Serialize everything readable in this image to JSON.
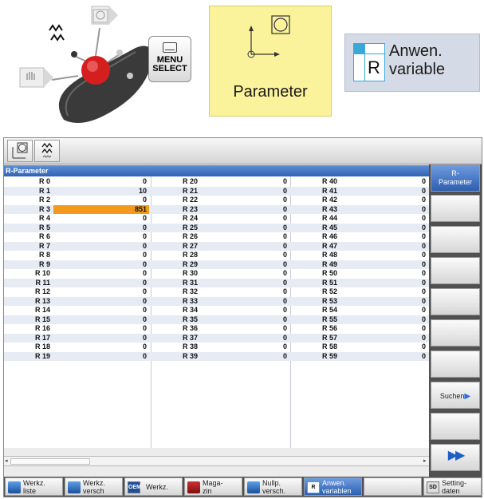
{
  "illustration": {
    "menu_key": {
      "line1": "MENU",
      "line2": "SELECT"
    },
    "parameter_label": "Parameter",
    "anwen": {
      "icon_letter": "R",
      "line1": "Anwen.",
      "line2": "variable"
    }
  },
  "screen": {
    "title": "R-Parameter",
    "table": {
      "selected_row": 3,
      "rows": [
        {
          "n0": "R 0",
          "v0": "0",
          "n1": "R 20",
          "v1": "0",
          "n2": "R 40",
          "v2": "0"
        },
        {
          "n0": "R 1",
          "v0": "10",
          "n1": "R 21",
          "v1": "0",
          "n2": "R 41",
          "v2": "0"
        },
        {
          "n0": "R 2",
          "v0": "0",
          "n1": "R 22",
          "v1": "0",
          "n2": "R 42",
          "v2": "0"
        },
        {
          "n0": "R 3",
          "v0": "851",
          "n1": "R 23",
          "v1": "0",
          "n2": "R 43",
          "v2": "0"
        },
        {
          "n0": "R 4",
          "v0": "0",
          "n1": "R 24",
          "v1": "0",
          "n2": "R 44",
          "v2": "0"
        },
        {
          "n0": "R 5",
          "v0": "0",
          "n1": "R 25",
          "v1": "0",
          "n2": "R 45",
          "v2": "0"
        },
        {
          "n0": "R 6",
          "v0": "0",
          "n1": "R 26",
          "v1": "0",
          "n2": "R 46",
          "v2": "0"
        },
        {
          "n0": "R 7",
          "v0": "0",
          "n1": "R 27",
          "v1": "0",
          "n2": "R 47",
          "v2": "0"
        },
        {
          "n0": "R 8",
          "v0": "0",
          "n1": "R 28",
          "v1": "0",
          "n2": "R 48",
          "v2": "0"
        },
        {
          "n0": "R 9",
          "v0": "0",
          "n1": "R 29",
          "v1": "0",
          "n2": "R 49",
          "v2": "0"
        },
        {
          "n0": "R 10",
          "v0": "0",
          "n1": "R 30",
          "v1": "0",
          "n2": "R 50",
          "v2": "0"
        },
        {
          "n0": "R 11",
          "v0": "0",
          "n1": "R 31",
          "v1": "0",
          "n2": "R 51",
          "v2": "0"
        },
        {
          "n0": "R 12",
          "v0": "0",
          "n1": "R 32",
          "v1": "0",
          "n2": "R 52",
          "v2": "0"
        },
        {
          "n0": "R 13",
          "v0": "0",
          "n1": "R 33",
          "v1": "0",
          "n2": "R 53",
          "v2": "0"
        },
        {
          "n0": "R 14",
          "v0": "0",
          "n1": "R 34",
          "v1": "0",
          "n2": "R 54",
          "v2": "0"
        },
        {
          "n0": "R 15",
          "v0": "0",
          "n1": "R 35",
          "v1": "0",
          "n2": "R 55",
          "v2": "0"
        },
        {
          "n0": "R 16",
          "v0": "0",
          "n1": "R 36",
          "v1": "0",
          "n2": "R 56",
          "v2": "0"
        },
        {
          "n0": "R 17",
          "v0": "0",
          "n1": "R 37",
          "v1": "0",
          "n2": "R 57",
          "v2": "0"
        },
        {
          "n0": "R 18",
          "v0": "0",
          "n1": "R 38",
          "v1": "0",
          "n2": "R 58",
          "v2": "0"
        },
        {
          "n0": "R 19",
          "v0": "0",
          "n1": "R 39",
          "v1": "0",
          "n2": "R 59",
          "v2": "0"
        }
      ]
    },
    "vertical_softkeys": {
      "k1_line1": "R-",
      "k1_line2": "Parameter",
      "search": "Suchen",
      "more": "▶▶"
    },
    "horizontal_softkeys": [
      {
        "l1": "Werkz.",
        "l2": "liste",
        "icon": "tool-list-icon"
      },
      {
        "l1": "Werkz.",
        "l2": "versch",
        "icon": "tool-wear-icon"
      },
      {
        "l1": "Werkz.",
        "l2": "",
        "icon": "oem-icon",
        "badge": "OEM"
      },
      {
        "l1": "Maga-",
        "l2": "zin",
        "icon": "magazine-icon"
      },
      {
        "l1": "Nullp.",
        "l2": "versch.",
        "icon": "zero-offset-icon"
      },
      {
        "l1": "Anwen.",
        "l2": "variablen",
        "icon": "user-variable-icon",
        "badge": "R"
      },
      {
        "l1": "",
        "l2": "",
        "icon": ""
      },
      {
        "l1": "Setting-",
        "l2": "daten",
        "icon": "setting-data-icon",
        "badge": "SD"
      }
    ],
    "colors": {
      "selected": "#f39a1c",
      "accent": "#2f62b2"
    }
  }
}
